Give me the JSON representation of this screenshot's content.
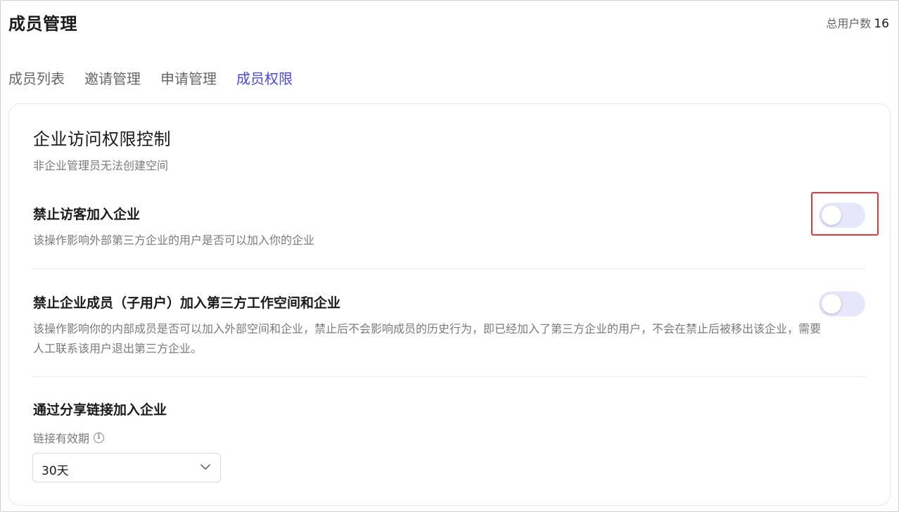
{
  "header": {
    "title": "成员管理",
    "user_count_label": "总用户数",
    "user_count": "16"
  },
  "tabs": [
    {
      "label": "成员列表",
      "active": false
    },
    {
      "label": "邀请管理",
      "active": false
    },
    {
      "label": "申请管理",
      "active": false
    },
    {
      "label": "成员权限",
      "active": true
    }
  ],
  "section": {
    "title": "企业访问权限控制",
    "subtitle": "非企业管理员无法创建空间"
  },
  "settings": [
    {
      "title": "禁止访客加入企业",
      "description": "该操作影响外部第三方企业的用户是否可以加入你的企业",
      "enabled": false
    },
    {
      "title": "禁止企业成员（子用户）加入第三方工作空间和企业",
      "description": "该操作影响你的内部成员是否可以加入外部空间和企业，禁止后不会影响成员的历史行为，即已经加入了第三方企业的用户，不会在禁止后被移出该企业，需要人工联系该用户退出第三方企业。",
      "enabled": false
    }
  ],
  "share_link": {
    "title": "通过分享链接加入企业",
    "validity_label": "链接有效期",
    "validity_value": "30天",
    "info_icon": "info-icon",
    "chevron_icon": "chevron-down-icon"
  },
  "colors": {
    "accent": "#4b47e0",
    "toggle_track": "#e6e7fb",
    "highlight": "#e0393e"
  }
}
